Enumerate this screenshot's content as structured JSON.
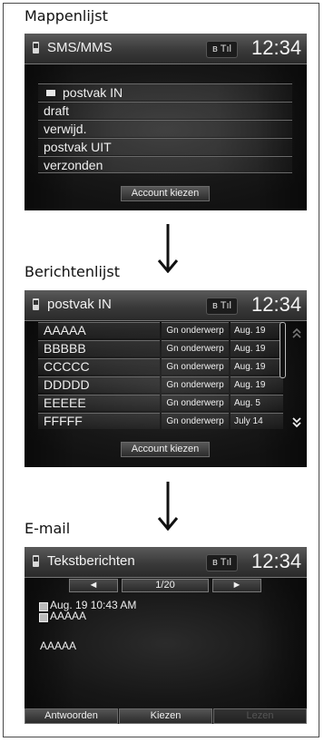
{
  "sections": {
    "folders_label": "Mappenlijst",
    "messages_label": "Berichtenlijst",
    "email_label": "E-mail"
  },
  "status": {
    "bt": "ʙ Tıl",
    "clock": "12:34"
  },
  "screen1": {
    "title": "SMS/MMS",
    "folders": [
      "postvak IN",
      "draft",
      "verwijd.",
      "postvak UIT",
      "verzonden"
    ],
    "button": "Account kiezen"
  },
  "screen2": {
    "title": "postvak IN",
    "messages": [
      {
        "from": "AAAAA",
        "subject": "Gn onderwerp",
        "date": "Aug. 19"
      },
      {
        "from": "BBBBB",
        "subject": "Gn onderwerp",
        "date": "Aug. 19"
      },
      {
        "from": "CCCCC",
        "subject": "Gn onderwerp",
        "date": "Aug. 19"
      },
      {
        "from": "DDDDD",
        "subject": "Gn onderwerp",
        "date": "Aug. 19"
      },
      {
        "from": "EEEEE",
        "subject": "Gn onderwerp",
        "date": "Aug. 5"
      },
      {
        "from": "FFFFF",
        "subject": "Gn onderwerp",
        "date": "July 14"
      }
    ],
    "button": "Account kiezen"
  },
  "screen3": {
    "title": "Tekstberichten",
    "prev": "◄",
    "page": "1/20",
    "next": "►",
    "datetime": "Aug. 19 10:43 AM",
    "sender": "AAAAA",
    "body": "AAAAA",
    "buttons": [
      "Antwoorden",
      "Kiezen",
      "Lezen"
    ]
  }
}
